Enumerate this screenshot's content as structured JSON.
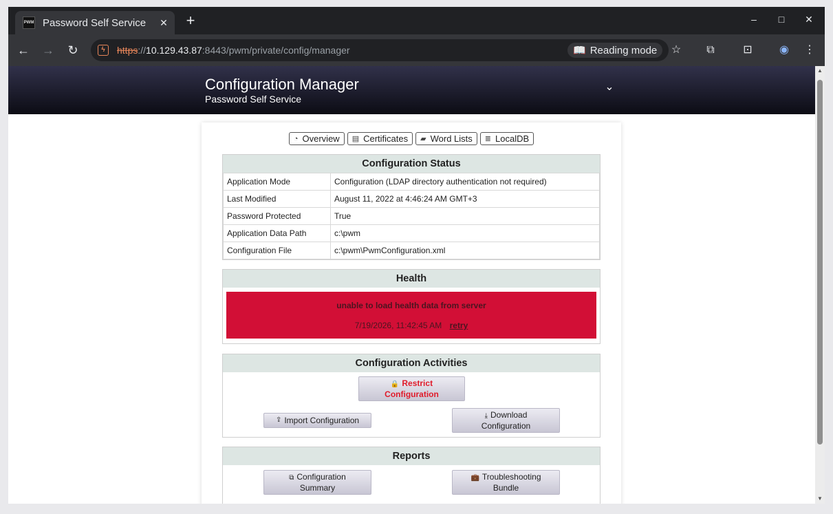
{
  "browser": {
    "tab_title": "Password Self Service",
    "favicon_text": "PWM",
    "url_scheme": "https",
    "url_sep": "://",
    "url_host": "10.129.43.87",
    "url_rest": ":8443/pwm/private/config/manager",
    "reading_mode": "Reading mode",
    "icons": [
      "back-icon",
      "forward-icon",
      "reload-icon",
      "star-icon",
      "extensions-icon",
      "tab-search-icon",
      "profile-icon",
      "menu-icon"
    ]
  },
  "header": {
    "title": "Configuration Manager",
    "subtitle": "Password Self Service"
  },
  "nav": {
    "overview": "Overview",
    "certificates": "Certificates",
    "wordlists": "Word Lists",
    "localdb": "LocalDB"
  },
  "config_status": {
    "title": "Configuration Status",
    "rows": [
      {
        "key": "Application Mode",
        "value": "Configuration (LDAP directory authentication not required)"
      },
      {
        "key": "Last Modified",
        "value": "August 11, 2022 at 4:46:24 AM GMT+3"
      },
      {
        "key": "Password Protected",
        "value": "True"
      },
      {
        "key": "Application Data Path",
        "value": "c:\\pwm"
      },
      {
        "key": "Configuration File",
        "value": "c:\\pwm\\PwmConfiguration.xml"
      }
    ]
  },
  "health": {
    "title": "Health",
    "message": "unable to load health data from server",
    "timestamp": "7/19/2026, 11:42:45 AM",
    "retry": "retry",
    "color": "#d20f36"
  },
  "activities": {
    "title": "Configuration Activities",
    "restrict": "Restrict Configuration",
    "import": "Import Configuration",
    "download": "Download Configuration"
  },
  "reports": {
    "title": "Reports",
    "summary": "Configuration Summary",
    "bundle": "Troubleshooting Bundle"
  }
}
